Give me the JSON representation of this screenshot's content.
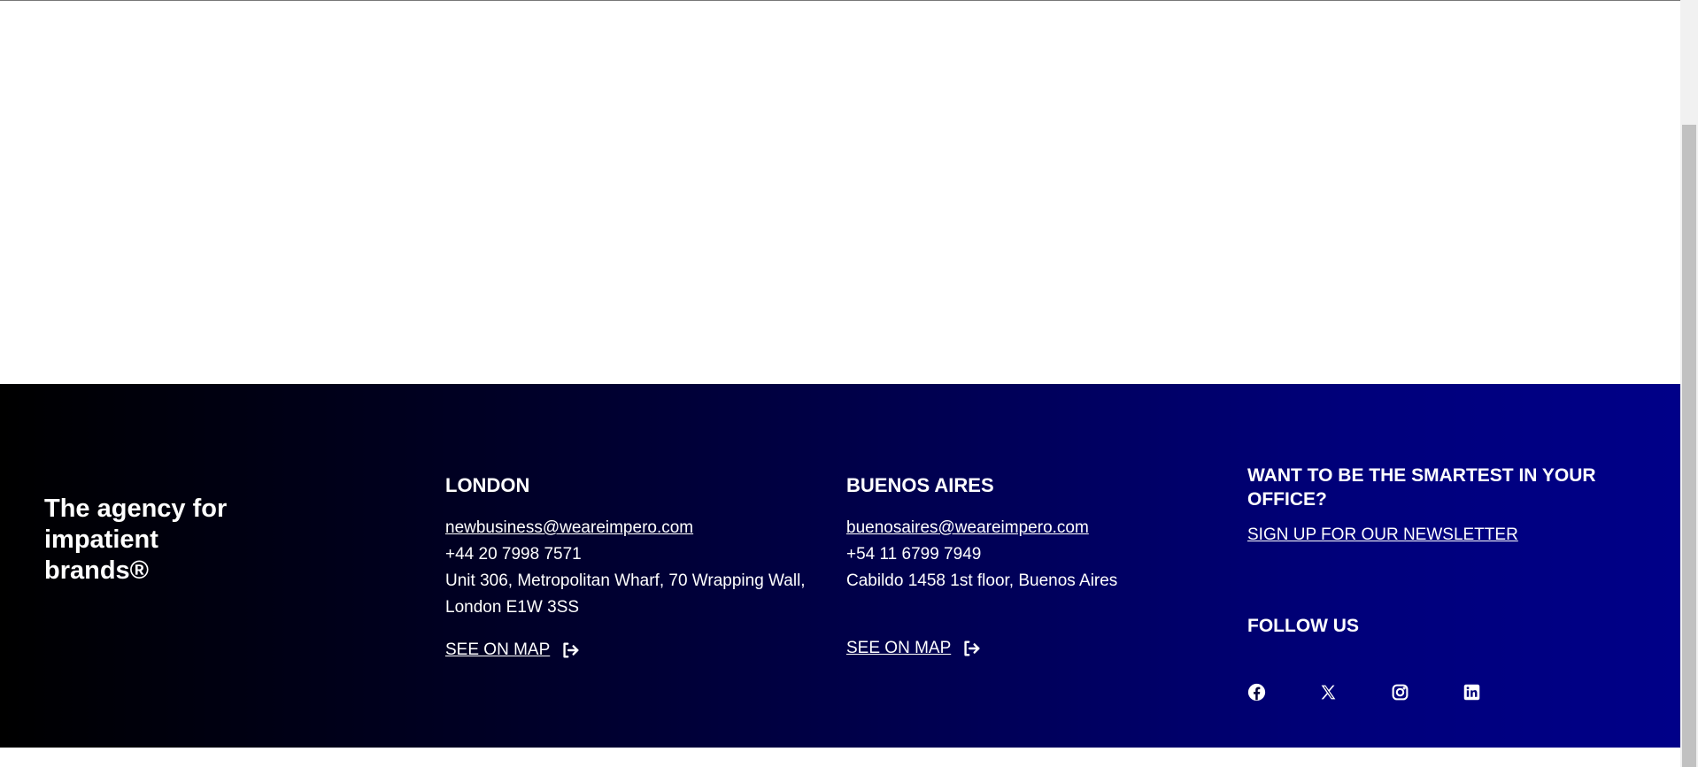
{
  "footer": {
    "tagline": "The agency for impatient brands®",
    "london": {
      "title": "LONDON",
      "email": "newbusiness@weareimpero.com",
      "phone": "+44 20 7998 7571",
      "address": "Unit 306, Metropolitan Wharf, 70 Wrapping Wall, London E1W 3SS",
      "map_label": "SEE ON MAP"
    },
    "buenos_aires": {
      "title": "BUENOS AIRES",
      "email": "buenosaires@weareimpero.com",
      "phone": "+54 11 6799 7949",
      "address": "Cabildo 1458 1st floor, Buenos Aires",
      "map_label": "SEE ON MAP"
    },
    "newsletter": {
      "title": "WANT TO BE THE SMARTEST IN YOUR OFFICE?",
      "link_label": "SIGN UP FOR OUR NEWSLETTER"
    },
    "follow": {
      "title": "FOLLOW US",
      "icons": [
        "facebook-icon",
        "x-twitter-icon",
        "instagram-icon",
        "linkedin-icon"
      ]
    }
  },
  "colors": {
    "gradient_start": "#000000",
    "gradient_end": "#000088",
    "text": "#ffffff"
  }
}
